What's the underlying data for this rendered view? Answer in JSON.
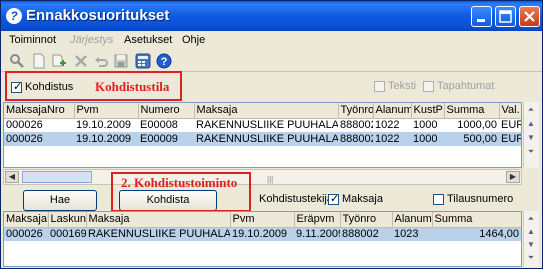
{
  "window": {
    "title": "Ennakkosuoritukset"
  },
  "menu": [
    {
      "label": "Toiminnot",
      "disabled": false
    },
    {
      "label": "Järjestys",
      "disabled": true
    },
    {
      "label": "Asetukset",
      "disabled": false
    },
    {
      "label": "Ohje",
      "disabled": false
    }
  ],
  "toolbar": {
    "icons": [
      "search-icon",
      "new-document-icon",
      "add-icon",
      "delete-icon",
      "undo-icon",
      "save-icon",
      "calculator-icon",
      "help-icon"
    ]
  },
  "top_filter": {
    "kohdistus_label": "Kohdistus",
    "kohdistus_checked": true,
    "annotation_1": "Kohdistustila",
    "teksti_label": "Teksti",
    "tapahtumat_label": "Tapahtumat"
  },
  "top_grid": {
    "columns": [
      "MaksajaNro",
      "Pvm",
      "Numero",
      "Maksaja",
      "Työnro",
      "Alanum",
      "KustP",
      "Summa",
      "Val."
    ],
    "rows": [
      {
        "maksajanro": "000026",
        "pvm": "19.10.2009",
        "numero": "E00008",
        "maksaja": "RAKENNUSLIIKE PUUHALA",
        "tyonro": "888002",
        "alanum": "1022",
        "kustp": "1000",
        "summa": "1000,00",
        "val": "EUR",
        "selected": false
      },
      {
        "maksajanro": "000026",
        "pvm": "19.10.2009",
        "numero": "E00009",
        "maksaja": "RAKENNUSLIIKE PUUHALA",
        "tyonro": "888002",
        "alanum": "1022",
        "kustp": "1000",
        "summa": "500,00",
        "val": "EUR",
        "selected": true
      }
    ]
  },
  "middle": {
    "hae_label": "Hae",
    "kohdista_label": "Kohdista",
    "annotation_2": "2. Kohdistustoiminto",
    "tekija_label": "Kohdistustekijä:",
    "maksaja_label": "Maksaja",
    "maksaja_checked": true,
    "tilausnumero_label": "Tilausnumero",
    "tilausnumero_checked": false
  },
  "bottom_grid": {
    "columns": [
      "MaksajaNro",
      "Laskun",
      "Maksaja",
      "Pvm",
      "Eräpvm",
      "Työnro",
      "Alanum",
      "Summa"
    ],
    "rows": [
      {
        "maksajanro": "000026",
        "laskun": "000169",
        "maksaja": "RAKENNUSLIIKE PUUHALA",
        "pvm": "19.10.2009",
        "erapvm": "9.11.2009",
        "tyonro": "888002",
        "alanum": "1023",
        "summa": "1464,00",
        "selected": true
      }
    ]
  }
}
